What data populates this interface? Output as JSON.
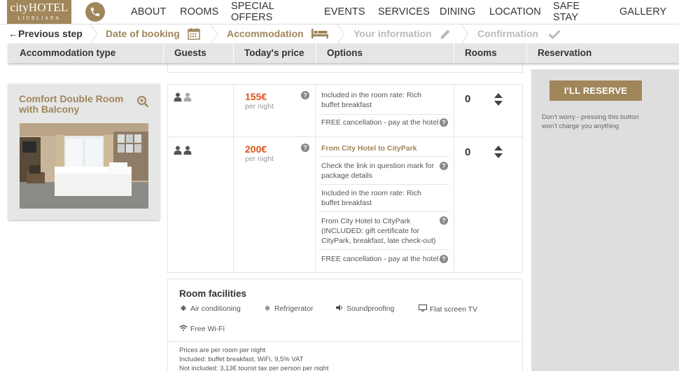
{
  "brand": {
    "logo_main": "cityHOTEL",
    "logo_sub": "LJUBLJANA",
    "accent": "#a0865a",
    "price_color": "#d9541e"
  },
  "nav": {
    "phone_icon": "phone-icon",
    "items": [
      "ABOUT",
      "ROOMS",
      "SPECIAL OFFERS",
      "EVENTS",
      "SERVICES",
      "DINING",
      "LOCATION",
      "SAFE STAY",
      "GALLERY"
    ]
  },
  "steps": {
    "previous": "Previous step",
    "items": [
      {
        "label": "Date of booking",
        "icon": "calendar-icon",
        "state": "done"
      },
      {
        "label": "Accommodation",
        "icon": "bed-icon",
        "state": "done"
      },
      {
        "label": "Your information",
        "icon": "pencil-icon",
        "state": "todo"
      },
      {
        "label": "Confirmation",
        "icon": "check-icon",
        "state": "todo"
      }
    ]
  },
  "columns": [
    "Accommodation type",
    "Guests",
    "Today's price",
    "Options",
    "Rooms",
    "Reservation"
  ],
  "room": {
    "title": "Comfort Double Room with Balcony",
    "zoom_icon": "zoom-in-icon"
  },
  "rates": [
    {
      "guests_icon": "two-guests-one-faded-icon",
      "price": "155€",
      "per": "per night",
      "options": [
        {
          "text": "Included in the room rate: Rich buffet breakfast",
          "bold": false
        },
        {
          "text": "FREE cancellation - pay at the hotel",
          "bold": false
        }
      ],
      "rooms": "0"
    },
    {
      "guests_icon": "two-guests-icon",
      "price": "200€",
      "per": "per night",
      "options": [
        {
          "text": "From City Hotel to CityPark",
          "bold": true
        },
        {
          "text": "Check the link in question mark for package details",
          "bold": false
        },
        {
          "text": "Included in the room rate: Rich buffet breakfast",
          "bold": false
        },
        {
          "text": "From City Hotel to CityPark (INCLUDED: gift certificate for CityPark, breakfast, late check-out)",
          "bold": false
        },
        {
          "text": "FREE cancellation - pay at the hotel",
          "bold": false
        }
      ],
      "rooms": "0"
    }
  ],
  "facilities": {
    "title": "Room facilities",
    "items": [
      {
        "label": "Air conditioning",
        "icon": "snowflake-icon"
      },
      {
        "label": "Refrigerator",
        "icon": "refrigerator-icon"
      },
      {
        "label": "Soundproofing",
        "icon": "speaker-icon"
      },
      {
        "label": "Flat screen TV",
        "icon": "tv-icon"
      },
      {
        "label": "Free Wi-Fi",
        "icon": "wifi-icon"
      }
    ],
    "notes": [
      "Prices are per room per night",
      "Included: buffet breakfast, WiFi, 9,5% VAT",
      "Not included: 3,13€ tourist tax per person per night"
    ]
  },
  "reservation": {
    "button": "I'LL RESERVE",
    "note": "Don't worry - pressing this button won't charge you anything"
  }
}
